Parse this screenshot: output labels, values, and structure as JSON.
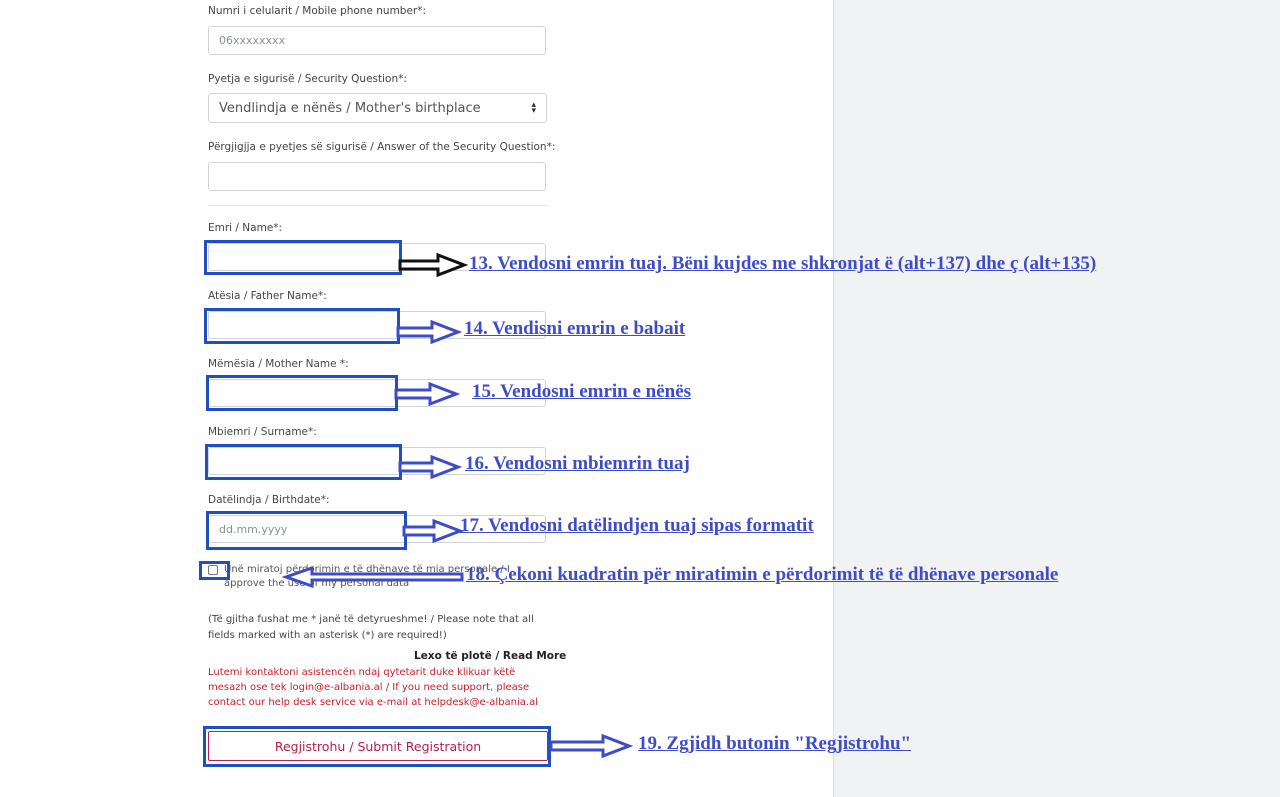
{
  "form": {
    "phone": {
      "label": "Numri i celularit / Mobile phone number*:",
      "placeholder": "06xxxxxxxx"
    },
    "security_question": {
      "label": "Pyetja e sigurisë / Security Question*:",
      "selected": "Vendlindja e nënës / Mother's birthplace"
    },
    "security_answer": {
      "label": "Përgjigjja e pyetjes së sigurisë / Answer of the Security Question*:"
    },
    "name": {
      "label": "Emri / Name*:"
    },
    "father_name": {
      "label": "Atësia / Father Name*:"
    },
    "mother_name": {
      "label": "Mëmësia / Mother Name *:"
    },
    "surname": {
      "label": "Mbiemri / Surname*:"
    },
    "birthdate": {
      "label": "Datëlindja / Birthdate*:",
      "placeholder": "dd.mm.yyyy"
    },
    "consent": {
      "label": "Unë miratoj përdorimin e të dhënave të mia personale / I approve the use of my personal data"
    },
    "required_note": "(Të gjitha fushat me * janë të detyrueshme! / Please note that all fields marked with an asterisk (*) are required!)",
    "read_more": "Lexo të plotë / Read More",
    "support_text": "Lutemi kontaktoni asistencën ndaj qytetarit duke klikuar këtë mesazh ose tek login@e-albania.al / If you need support, please contact our help desk service via e-mail at helpdesk@e-albania.al",
    "submit_label": "Regjistrohu / Submit Registration"
  },
  "annotations": {
    "a13": "13. Vendosni emrin tuaj. Bëni kujdes me shkronjat ë (alt+137) dhe ç (alt+135)",
    "a14": "14. Vendisni emrin e babait",
    "a15": "15. Vendosni emrin e nënës",
    "a16": "16. Vendosni mbiemrin tuaj",
    "a17": "17. Vendosni datëlindjen tuaj sipas formatit",
    "a18": "18. Çekoni kuadratin për miratimin e përdorimit të të dhënave personale",
    "a19": "19. Zgjidh butonin \"Regjistrohu\""
  },
  "colors": {
    "highlight": "#1f4fc0",
    "annotation_text": "#3e4cc8",
    "submit": "#b5204e",
    "support_text": "#c8202c"
  }
}
